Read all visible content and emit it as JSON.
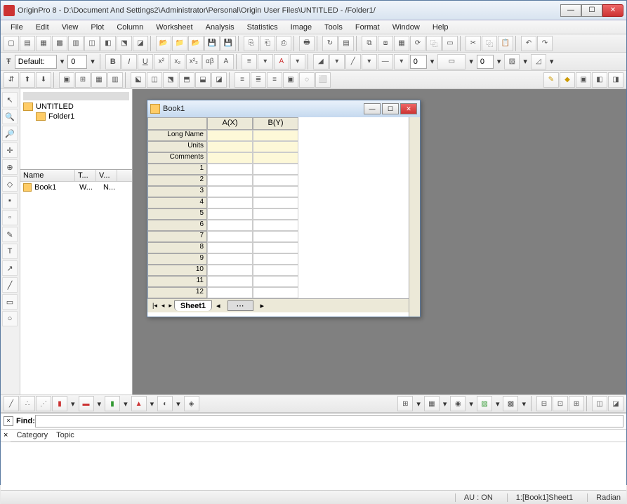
{
  "app": {
    "name": "OriginPro 8",
    "title_path": "D:\\Document And Settings2\\Administrator\\Personal\\Origin User Files\\UNTITLED - /Folder1/"
  },
  "menu": [
    "File",
    "Edit",
    "View",
    "Plot",
    "Column",
    "Worksheet",
    "Analysis",
    "Statistics",
    "Image",
    "Tools",
    "Format",
    "Window",
    "Help"
  ],
  "font_toolbar": {
    "label": "Default:",
    "size": "0"
  },
  "project": {
    "root": "UNTITLED",
    "folder": "Folder1"
  },
  "filelist": {
    "cols": [
      "Name",
      "T...",
      "V..."
    ],
    "rows": [
      {
        "name": "Book1",
        "t": "W...",
        "v": "N..."
      }
    ]
  },
  "workbook": {
    "title": "Book1",
    "columns": [
      "A(X)",
      "B(Y)"
    ],
    "meta_rows": [
      "Long Name",
      "Units",
      "Comments"
    ],
    "data_rows": [
      "1",
      "2",
      "3",
      "4",
      "5",
      "6",
      "7",
      "8",
      "9",
      "10",
      "11",
      "12"
    ],
    "sheet": "Sheet1"
  },
  "find": {
    "label": "Find:",
    "hdr": [
      "Category",
      "Topic"
    ]
  },
  "status": {
    "au": "AU : ON",
    "loc": "1:[Book1]Sheet1",
    "angle": "Radian"
  },
  "combo_zero": "0"
}
